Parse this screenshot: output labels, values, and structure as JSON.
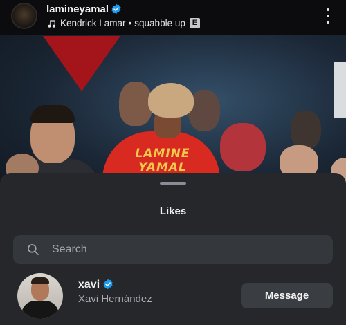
{
  "story": {
    "username": "lamineyamal",
    "verified": true,
    "music": {
      "artist": "Kendrick Lamar",
      "separator": "•",
      "track": "squabble up",
      "explicit_label": "E"
    },
    "photo": {
      "jersey_text": "LAMINE YAMAL"
    }
  },
  "likes_sheet": {
    "title": "Likes",
    "search": {
      "placeholder": "Search",
      "value": ""
    },
    "users": [
      {
        "username": "xavi",
        "full_name": "Xavi Hernández",
        "verified": true,
        "action_label": "Message"
      }
    ]
  },
  "icons": {
    "verified": "verified-badge-icon",
    "music": "music-note-icon",
    "more": "more-vertical-icon",
    "search": "search-icon"
  },
  "colors": {
    "verified_blue": "#1d9bf0",
    "sheet_bg": "#25272b",
    "search_bg": "#34373c",
    "button_bg": "#3a3d42",
    "jersey_red": "#d92a22",
    "jersey_text": "#f2c94c"
  }
}
